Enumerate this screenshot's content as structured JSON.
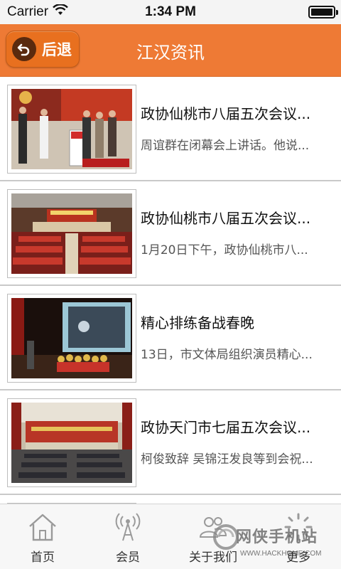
{
  "status_bar": {
    "carrier": "Carrier",
    "time": "1:34 PM",
    "battery_level": 1.0,
    "wifi_icon": "wifi-icon",
    "battery_icon": "battery-icon"
  },
  "header": {
    "back_label": "后退",
    "back_icon": "back-arrow-icon",
    "title": "江汉资讯",
    "bg_color": "#ee7a35"
  },
  "news": [
    {
      "title": "政协仙桃市八届五次会议...",
      "summary": "周谊群在闭幕会上讲话。他说...",
      "thumb": "ceremony-photo"
    },
    {
      "title": "政协仙桃市八届五次会议...",
      "summary": "1月20日下午，政协仙桃市八...",
      "thumb": "conference-hall-photo"
    },
    {
      "title": "精心排练备战春晚",
      "summary": "13日，市文体局组织演员精心...",
      "thumb": "stage-rehearsal-photo"
    },
    {
      "title": "政协天门市七届五次会议...",
      "summary": "柯俊致辞 吴锦汪发良等到会祝...",
      "thumb": "auditorium-photo"
    }
  ],
  "tabs": [
    {
      "label": "首页",
      "icon": "home-icon"
    },
    {
      "label": "会员",
      "icon": "broadcast-icon"
    },
    {
      "label": "关于我们",
      "icon": "people-icon"
    },
    {
      "label": "更多",
      "icon": "more-icon"
    }
  ],
  "watermark": {
    "main": "网侠手机站",
    "sub": "WWW.HACKHOME.COM"
  }
}
